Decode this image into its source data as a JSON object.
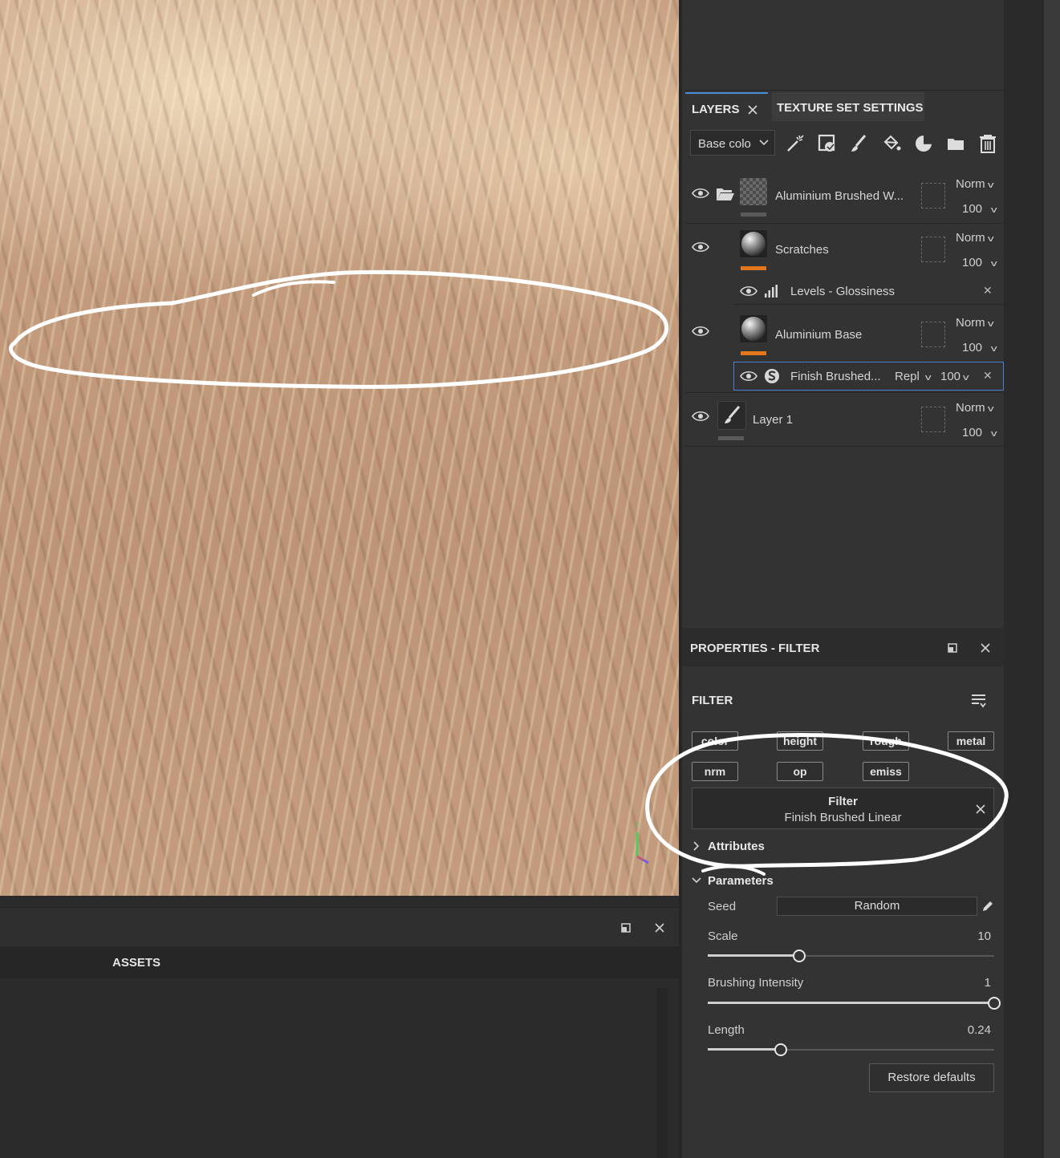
{
  "layers_panel": {
    "tabs": [
      {
        "label": "LAYERS"
      },
      {
        "label": "TEXTURE SET SETTINGS"
      }
    ],
    "channel_select": "Base colo",
    "layers": [
      {
        "name": "Aluminium Brushed W...",
        "blend": "Norm",
        "opacity": "100",
        "type": "folder",
        "bar_color": "#5a5a5a"
      },
      {
        "name": "Scratches",
        "blend": "Norm",
        "opacity": "100",
        "type": "fill",
        "bar_color": "#e2761c"
      },
      {
        "name": "Aluminium Base",
        "blend": "Norm",
        "opacity": "100",
        "type": "fill",
        "bar_color": "#e2761c"
      },
      {
        "name": "Layer 1",
        "blend": "Norm",
        "opacity": "100",
        "type": "paint",
        "bar_color": "#5a5a5a"
      }
    ],
    "effects": [
      {
        "name": "Levels - Glossiness"
      },
      {
        "name": "Finish Brushed...",
        "blend": "Repl",
        "opacity": "100"
      }
    ]
  },
  "properties": {
    "title": "PROPERTIES - FILTER",
    "section_label": "FILTER",
    "channels": [
      "color",
      "height",
      "rough",
      "metal",
      "nrm",
      "op",
      "emiss"
    ],
    "filter_box": {
      "title": "Filter",
      "subtitle": "Finish Brushed Linear"
    },
    "attributes_label": "Attributes",
    "parameters_label": "Parameters",
    "seed": {
      "label": "Seed",
      "value": "Random"
    },
    "scale": {
      "label": "Scale",
      "value": "10",
      "fraction": 0.32
    },
    "brushing_intensity": {
      "label": "Brushing Intensity",
      "value": "1",
      "fraction": 1.0
    },
    "length": {
      "label": "Length",
      "value": "0.24",
      "fraction": 0.255
    },
    "restore_label": "Restore defaults"
  },
  "assets": {
    "title": "ASSETS"
  },
  "colors": {
    "accent_tab": "#4a8fd8",
    "selection_border": "#4a7fd8",
    "layer_mask_bar": "#e2761c",
    "annotation": "#ffffff"
  }
}
